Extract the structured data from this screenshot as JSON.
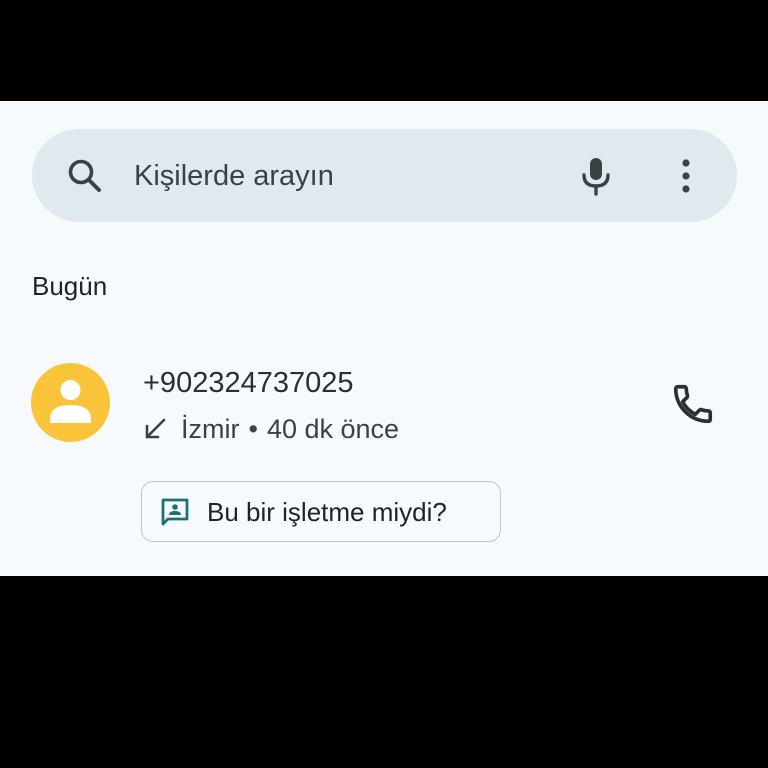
{
  "search": {
    "placeholder": "Kişilerde arayın",
    "icons": [
      "search-icon",
      "mic-icon",
      "more-vert-icon"
    ]
  },
  "history": {
    "section_title": "Bugün",
    "entries": [
      {
        "number": "+902324737025",
        "direction_icon": "call-received-icon",
        "location": "İzmir",
        "separator": "•",
        "time_ago": "40 dk önce",
        "avatar_icon": "person-icon",
        "action_icon": "phone-icon",
        "suggestion_chip": "Bu bir işletme miydi?",
        "suggestion_icon": "business-feedback-icon"
      }
    ]
  },
  "colors": {
    "background": "#f7fafd",
    "search_bar": "#dfe9ee",
    "avatar": "#f9c43a",
    "chip_icon": "#1f6f7a",
    "text_primary": "#1f2328",
    "text_secondary": "#3c4146"
  }
}
